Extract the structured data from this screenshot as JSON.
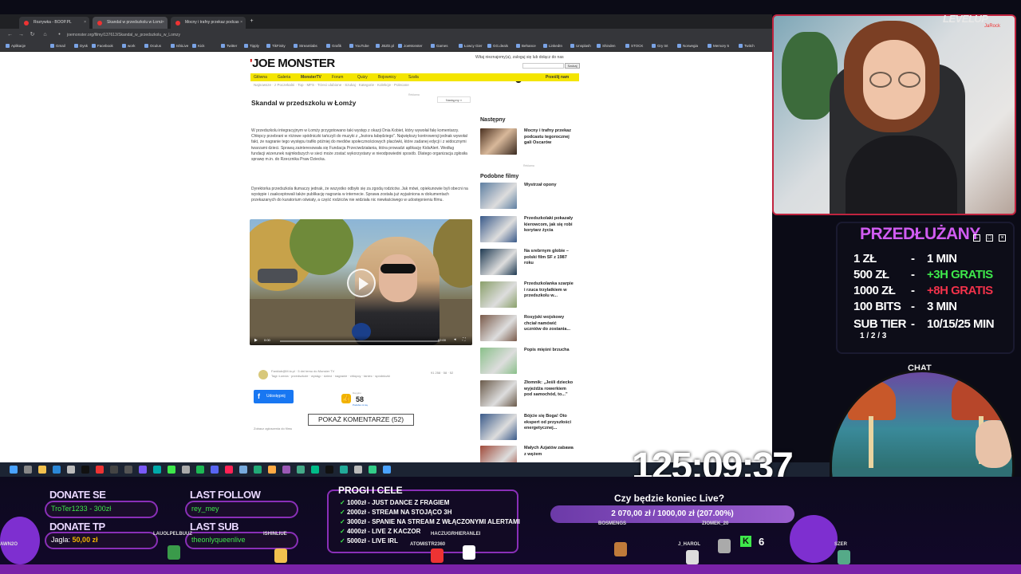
{
  "browser": {
    "tabs": [
      {
        "label": "Rozrywka - BOOP.PL"
      },
      {
        "label": "Skandal w przedszkolu w Łomż"
      },
      {
        "label": "Mocny i trafny przekaz podcas"
      }
    ],
    "url": "joemonster.org/filmy/137613/Skandal_w_przedszkolu_w_Lomzy",
    "bookmarks": [
      "Aplikacje",
      "Gmail",
      "Dysk",
      "Facebook",
      "work",
      "Oculus",
      "IshiLive",
      "Kick",
      "Twitter",
      "Tipply",
      "TikFinity",
      "Streamlabs",
      "Grafik",
      "YouTube",
      "JBZD.pl",
      "JoeMonster",
      "Games",
      "Łowcy Gier",
      "GG.deals",
      "Behance",
      "LinkedIn",
      "Unsplash",
      "Shinden",
      "STOCK",
      "Gry tnt",
      "Norwegia",
      "Memory 5",
      "Twitch"
    ]
  },
  "site": {
    "logo": "JOE MONSTER",
    "login_text": "Witaj nieznajomy(a), zaloguj się lub dołącz do nas",
    "search_btn": "Szukaj",
    "nav": [
      "Główna",
      "Galeria",
      "MonsterTV",
      "Forum",
      "Quizy",
      "Bojownicy",
      "Szafa"
    ],
    "nav_right": "Prześlij nam",
    "subnav": "Najnowsze  ·  z Poczekalni  ·  Top  ·  MFS  ·  Trzeci ulubione  ·  Szukaj  ·  Kategorie  ·  Kolekcje  ·  Polecane",
    "ad_label": "Reklama",
    "next_label": "Następny »"
  },
  "article": {
    "title": "Skandal w przedszkolu w Łomży",
    "para1": "W przedszkolu integracyjnym w Łomży przygotowano taki występ z okazji Dnia Kobiet, który wywołał falę komentarzy. Chłopcy przebrani w różowe spódniczki tańczyli do muzyki z „Jeziora łabędziego\". Największy kontrowersji jednak wywołał fakt, że nagranie tego występu trafiło później do mediów społecznościowych placówki, które zadanej edycji i z widocznymi twarzami dzieci. Sprawą zainteresowała się Fundacja Przeciwdziałania, która prowadzi aplikację KidsAlert. Według fundacji wizerunek najmłodszych w sieci może zostać wykorzystany w nieodpowiedni sposób. Dlatego organizacja zgłosiła sprawę m.in. do Rzecznika Praw Dziecka.",
    "para2": "Dyrektorka przedszkola tłumaczy jednak, że wszystko odbyło się za zgodą rodziców. Jak mówi, opiekunowie byli obecni na występie i zaakceptowali także publikację nagrania w internecie. Sprawa została już wyjaśniona w dokumentach przekazanych do kuratorium oświaty, a część rodziców nie widziała nic niewłaściwego w udostępnieniu filmu.",
    "video_time": "0:00",
    "video_duration": "02:00",
    "source": "Fanklub@M.tv.pl · 5 dni temu do Monster TV",
    "tags": "Tagi: Łomża · przedszkole · występ · dzieci · nagranie · chłopcy · taniec · spódniczki",
    "stats": "91 258 · 58 · 52",
    "share_label": "Udostępnij",
    "like_label": "Daj głos",
    "like_count": "58",
    "like_sub": "Podoba mi się",
    "comments_label": "POKAŻ KOMENTARZE (52)",
    "report": "Zobacz zgłoszenia do filmu"
  },
  "sidebar": {
    "next_heading": "Następny",
    "next_item": "Mocny i trafny przekaz podcastu tegorocznej gali Oscarów",
    "ad_label": "Reklama",
    "similar_heading": "Podobne filmy",
    "similar": [
      "Wystrzał opony",
      "Przedszkolaki pokazały kierowcom, jak się robi korytarz życia",
      "Na srebrnym globie – polski film SF z 1987 roku",
      "Przedszkolanka szarpie i rzuca trzylatkiem w przedszkolu w...",
      "Rosyjski wojskowy chciał namówić uczniów do zostania...",
      "Popis mięśni brzucha",
      "Złomnik: „Jeśli dziecko wyjeżdża rowerkiem pod samochód, to...\"",
      "Bójcie się Boga! Oto ekspert od przyszłości energetycznej...",
      "Małych Azjatów zabawa z wężem"
    ]
  },
  "stream": {
    "cam_logo": "LEVELUP",
    "cam_logo_sub": "JaRock",
    "przedluzany_title": "PRZEDŁUŻANY",
    "przedluzany_rows": [
      {
        "amount": "1 ZŁ",
        "dash": "-",
        "value": "1 MIN",
        "color": "#ffffff"
      },
      {
        "amount": "500 ZŁ",
        "dash": "-",
        "value": "+3H GRATIS",
        "color": "#3ee84b"
      },
      {
        "amount": "1000 ZŁ",
        "dash": "-",
        "value": "+8H GRATIS",
        "color": "#f2324a"
      },
      {
        "amount": "100 BITS",
        "dash": "-",
        "value": "3 MIN",
        "color": "#ffffff"
      },
      {
        "amount": "SUB TIER",
        "dash": "-",
        "value": "10/15/25 MIN",
        "color": "#ffffff"
      }
    ],
    "sub_tier_levels": "1 / 2 / 3",
    "chat_label": "CHAT",
    "timer": "125:09:37",
    "donate_se_label": "DONATE SE",
    "donate_se_value": "TroTer1233 - 300zł",
    "donate_tp_label": "DONATE TP",
    "donate_tp_name": "Jagla:",
    "donate_tp_value": "50,00 zł",
    "last_follow_label": "LAST FOLLOW",
    "last_follow_value": "rey_mey",
    "last_sub_label": "LAST SUB",
    "last_sub_value": "theonlyqueenlive",
    "progi_title": "PROGI I CELE",
    "progi": [
      "1000zł - JUST DANCE Z FRAGIEM",
      "2000zł - STREAM NA STOJĄCO 3H",
      "3000zł - SPANIE NA STREAM Z WŁĄCZONYMI ALERTAMI",
      "4000zł - LIVE Z KACZOR",
      "5000zł - LIVE IRL"
    ],
    "live_question": "Czy będzie koniec Live?",
    "live_progress_text": "2 070,00 zł / 1000,00 zł (207.00%)",
    "live_progress_fraction": 2.07,
    "usernames": [
      "LAUOLPELBUUZ",
      "ISHINLIUE",
      "AWN2O",
      "BOSMENGS",
      "ZIOMEK_20",
      "J_HAROL",
      "SZER",
      "ATOMISTR2360",
      "HACZUGRHIERANLEI"
    ],
    "counter": "6",
    "counter_icon": "K"
  }
}
